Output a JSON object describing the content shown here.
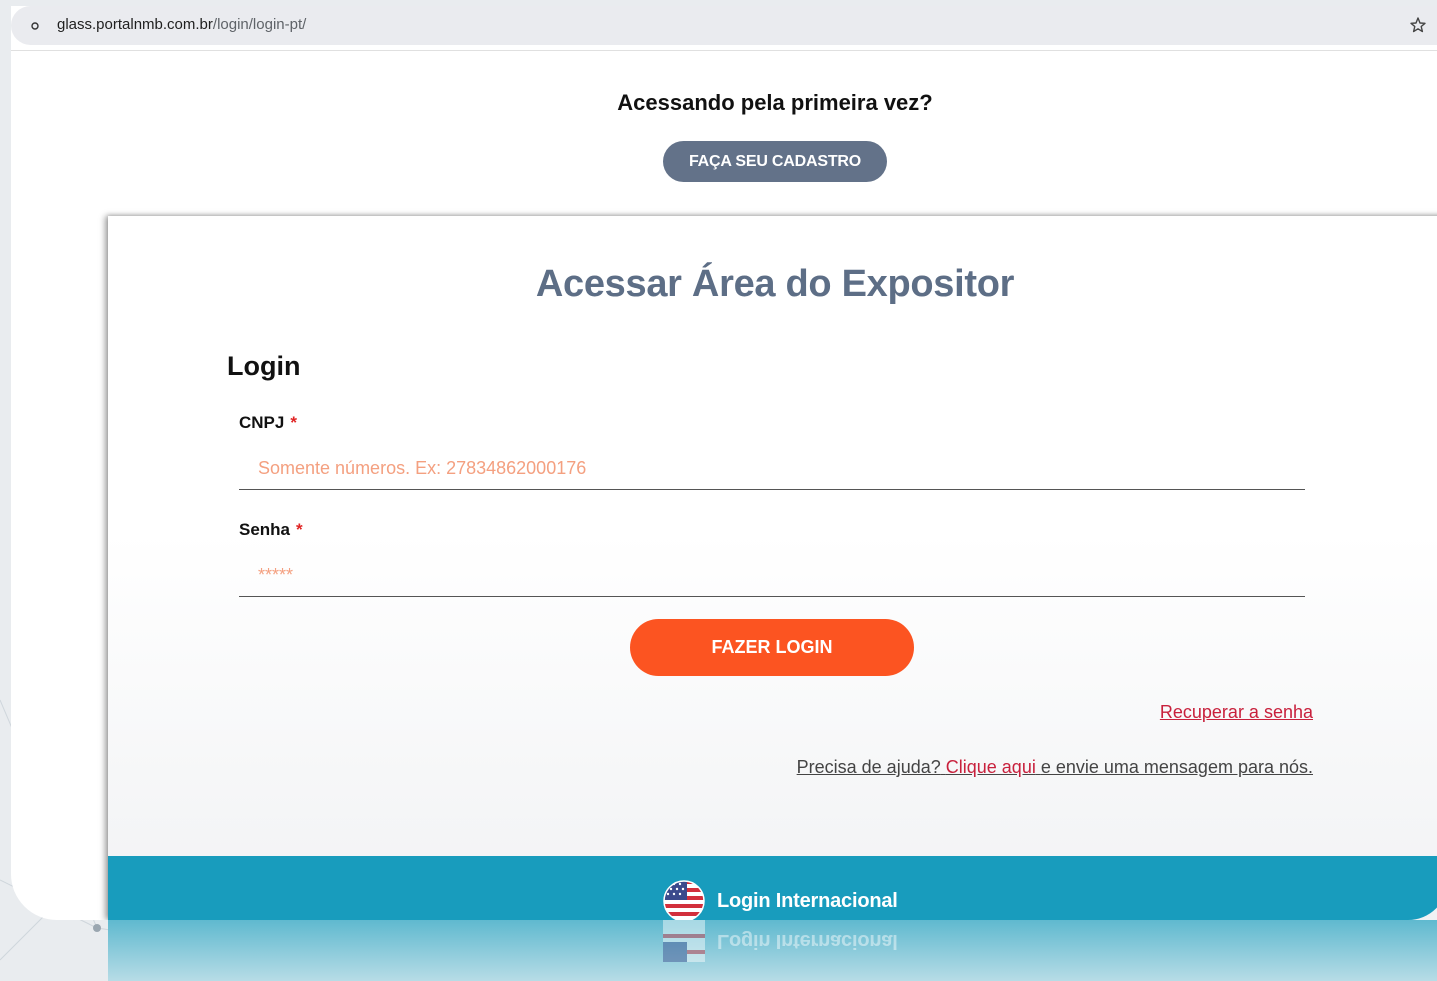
{
  "browser": {
    "url_host": "glass.portalnmb.com.br",
    "url_path": "/login/login-pt/"
  },
  "header": {
    "headline": "Acessando pela primeira vez?",
    "signup_button": "FAÇA SEU CADASTRO"
  },
  "card": {
    "title": "Acessar Área do Expositor",
    "section_title": "Login",
    "cnpj": {
      "label": "CNPJ",
      "required_mark": "*",
      "placeholder": "Somente números. Ex: 27834862000176",
      "value": ""
    },
    "password": {
      "label": "Senha",
      "required_mark": "*",
      "placeholder": "*****",
      "value": ""
    },
    "login_button": "FAZER LOGIN",
    "recover_link": "Recuperar a senha",
    "help": {
      "prefix": "Precisa de ajuda?",
      "link": "Clique aqui",
      "suffix": "e envie uma mensagem para nós."
    },
    "international": {
      "label": "Login Internacional",
      "icon": "us-flag-icon"
    }
  },
  "colors": {
    "accent_orange": "#fc5421",
    "slate_button": "#637289",
    "title_slate": "#5d6e86",
    "international_teal": "#189cbd",
    "link_red": "#c8203c",
    "required_red": "#e02424"
  }
}
